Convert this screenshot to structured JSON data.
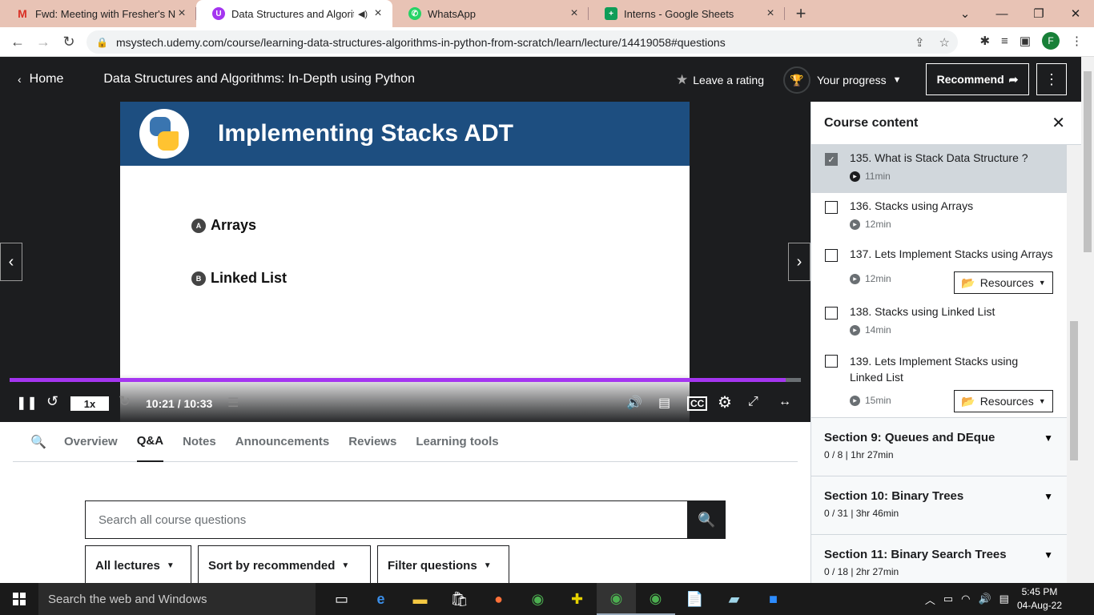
{
  "browser": {
    "tabs": [
      {
        "title": "Fwd: Meeting with Fresher's New",
        "icon": "gmail-icon",
        "color": "#d93025",
        "active": false
      },
      {
        "title": "Data Structures and Algorith",
        "icon": "udemy-icon",
        "color": "#a435f0",
        "active": true
      },
      {
        "title": "WhatsApp",
        "icon": "whatsapp-icon",
        "color": "#25d366",
        "active": false
      },
      {
        "title": "Interns - Google Sheets",
        "icon": "sheets-icon",
        "color": "#0f9d58",
        "active": false
      }
    ],
    "url": "msystech.udemy.com/course/learning-data-structures-algorithms-in-python-from-scratch/learn/lecture/14419058#questions",
    "profile_initial": "F"
  },
  "header": {
    "home_label": "Home",
    "course_title": "Data Structures and Algorithms: In-Depth using Python",
    "rating_label": "Leave a rating",
    "progress_label": "Your progress",
    "recommend_label": "Recommend"
  },
  "slide": {
    "title": "Implementing Stacks ADT",
    "bullets": [
      {
        "marker": "A",
        "text": "Arrays"
      },
      {
        "marker": "B",
        "text": "Linked List"
      }
    ]
  },
  "player": {
    "speed": "1x",
    "time": "10:21 / 10:33",
    "progress_fraction": 0.981,
    "accent": "#a435f0"
  },
  "tabs": [
    "Overview",
    "Q&A",
    "Notes",
    "Announcements",
    "Reviews",
    "Learning tools"
  ],
  "active_tab": "Q&A",
  "qa": {
    "search_placeholder": "Search all course questions",
    "filters": [
      "All lectures",
      "Sort by recommended",
      "Filter questions"
    ]
  },
  "sidebar": {
    "title": "Course content",
    "lectures": [
      {
        "title": "135. What is Stack Data Structure ?",
        "duration": "11min",
        "checked": true,
        "current": true,
        "resources": ""
      },
      {
        "title": "136. Stacks using Arrays",
        "duration": "12min",
        "checked": false,
        "current": false,
        "resources": ""
      },
      {
        "title": "137. Lets Implement Stacks using Arrays",
        "duration": "12min",
        "checked": false,
        "current": false,
        "resources": "Resources"
      },
      {
        "title": "138. Stacks using Linked List",
        "duration": "14min",
        "checked": false,
        "current": false,
        "resources": ""
      },
      {
        "title": "139. Lets Implement Stacks using Linked List",
        "duration": "15min",
        "checked": false,
        "current": false,
        "resources": "Resources"
      }
    ],
    "sections": [
      {
        "title": "Section 9: Queues and DEque",
        "sub": "0 / 8 | 1hr 27min"
      },
      {
        "title": "Section 10: Binary Trees",
        "sub": "0 / 31 | 3hr 46min"
      },
      {
        "title": "Section 11: Binary Search Trees",
        "sub": "0 / 18 | 2hr 27min"
      }
    ]
  },
  "taskbar": {
    "search_placeholder": "Search the web and Windows",
    "time": "5:45 PM",
    "date": "04-Aug-22"
  }
}
